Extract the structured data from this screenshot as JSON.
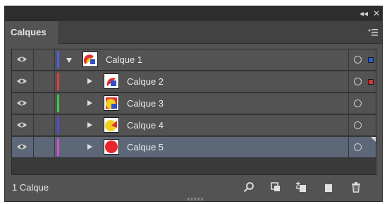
{
  "panel": {
    "tab_label": "Calques",
    "titlebar_collapse": "◂◂",
    "titlebar_close": "✕"
  },
  "layers": [
    {
      "name": "Calque 1",
      "color": "#4d5fe0",
      "expanded": true,
      "indent": 0,
      "thumb": "calque1",
      "target_square": "#2a5cd8",
      "selected": false
    },
    {
      "name": "Calque 2",
      "color": "#e03e3e",
      "expanded": false,
      "indent": 1,
      "thumb": "calque2",
      "target_square": "#e03030",
      "selected": false
    },
    {
      "name": "Calque 3",
      "color": "#3fc94a",
      "expanded": false,
      "indent": 1,
      "thumb": "calque3",
      "target_square": null,
      "selected": false
    },
    {
      "name": "Calque 4",
      "color": "#4d4de0",
      "expanded": false,
      "indent": 1,
      "thumb": "calque4",
      "target_square": null,
      "selected": false
    },
    {
      "name": "Calque 5",
      "color": "#d44ed4",
      "expanded": false,
      "indent": 1,
      "thumb": "calque5",
      "target_square": null,
      "selected": true
    }
  ],
  "footer": {
    "status": "1 Calque",
    "icons": [
      "search-icon",
      "clipping-mask-icon",
      "new-sublayer-icon",
      "new-layer-icon",
      "trash-icon"
    ]
  }
}
